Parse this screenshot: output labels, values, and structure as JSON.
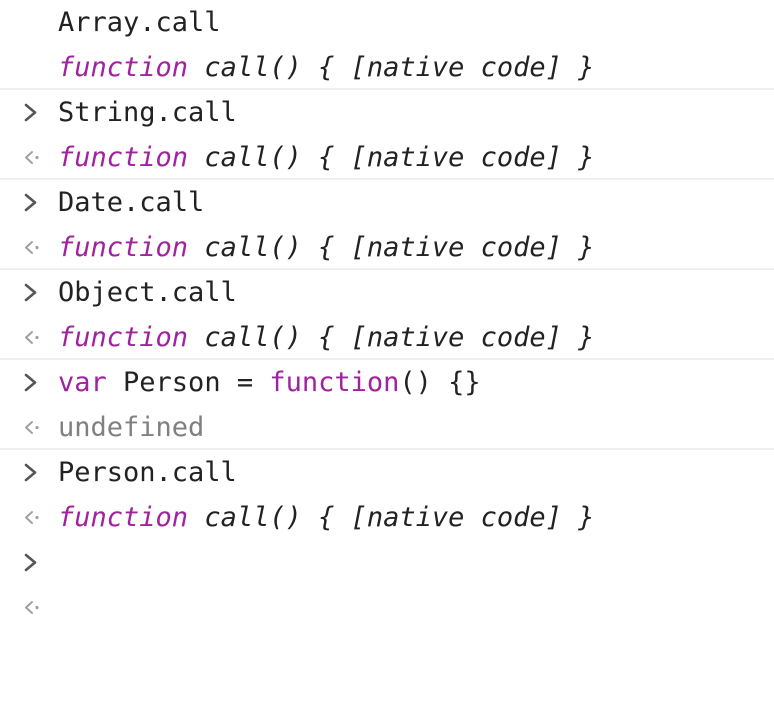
{
  "console": {
    "entries": [
      {
        "input": "Array.call",
        "output_keyword": "function",
        "output_rest": "call() { [native code] }"
      },
      {
        "input": "String.call",
        "output_keyword": "function",
        "output_rest": "call() { [native code] }"
      },
      {
        "input": "Date.call",
        "output_keyword": "function",
        "output_rest": "call() { [native code] }"
      },
      {
        "input": "Object.call",
        "output_keyword": "function",
        "output_rest": "call() { [native code] }"
      },
      {
        "input_var_kw": "var",
        "input_mid": " Person = ",
        "input_fn_kw": "function",
        "input_end": "() {}",
        "output_text": "undefined"
      },
      {
        "input": "Person.call",
        "output_keyword": "function",
        "output_rest": "call() { [native code] }"
      }
    ]
  },
  "icons": {
    "input_prompt": "chevron-right-icon",
    "output_prompt": "return-arrow-left-icon"
  },
  "colors": {
    "keyword": "#a0229f",
    "text": "#222222",
    "muted": "#808080",
    "prompt_input": "#555555",
    "prompt_output": "#a0a0a0",
    "divider": "#f0f0f0"
  }
}
